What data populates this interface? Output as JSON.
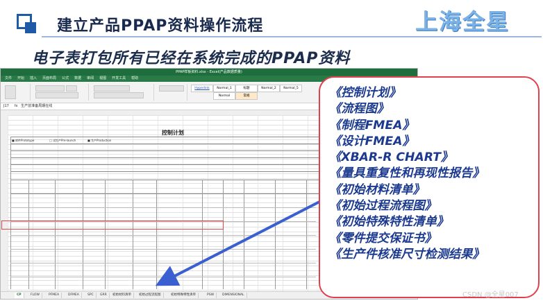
{
  "header": {
    "title": "建立产品PPAP资料操作流程",
    "brand": "上海全星",
    "subtitle": "电子表打包所有已经在系统完成的PPAP资料"
  },
  "excel": {
    "window_title": "PPAP样板资料.xlsx - Excel(产品数据质量)",
    "ribbon_tabs": [
      "文件",
      "开始",
      "插入",
      "页面布局",
      "公式",
      "数据",
      "审阅",
      "视图",
      "开发工具",
      "帮助"
    ],
    "cell_ref": "J17",
    "formula": "生产前准备周期在线",
    "styles": [
      "Hyperlink",
      "Normal_1",
      "标题",
      "Normal_2",
      "Normal_5",
      "Normal",
      "常规"
    ],
    "sheet_title": "控制计划",
    "phase_labels": [
      "样件Prototype",
      "试生产Pre-launch",
      "生产Production"
    ],
    "sheet_tabs": [
      "CP",
      "FLOW",
      "PFMEA",
      "DFMEA",
      "SPC",
      "GRR",
      "初始材料清单",
      "初始过程流程图",
      "初始特殊特性清单",
      "PSW",
      "DIMENSIONAL"
    ],
    "active_tab": "CP"
  },
  "documents": [
    "《控制计划》",
    "《流程图》",
    "《制程FMEA》",
    "《设计FMEA》",
    "《XBAR-R  CHART》",
    "《量具重复性和再现性报告》",
    "《初始材料清单》",
    "《初始过程流程图》",
    "《初始特殊特性清单》",
    "《零件提交保证书》",
    "《生产件核准尺寸检测结果》"
  ],
  "watermark": "CSDN @全星007",
  "colors": {
    "accent_blue": "#1f5aa6",
    "list_text": "#1b3a8f",
    "highlight_red": "#e04848",
    "arrow": "#3a5fd0",
    "excel_green": "#1e6e3d"
  }
}
